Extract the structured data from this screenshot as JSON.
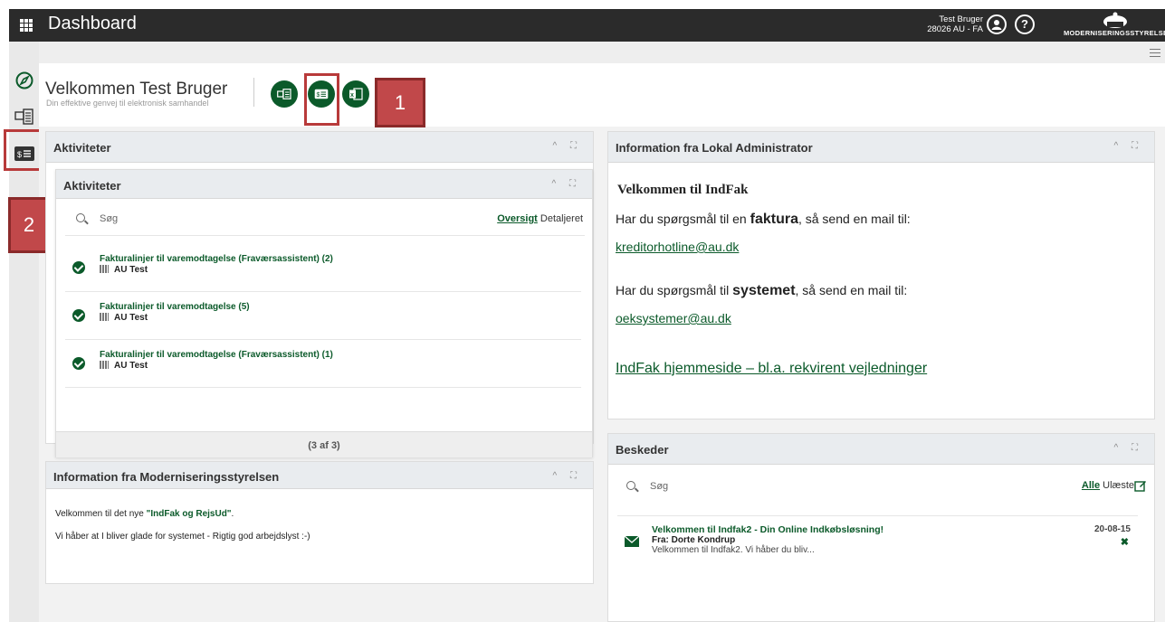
{
  "topbar": {
    "title": "Dashboard",
    "user_name": "Test Bruger",
    "user_org": "28026 AU - FA",
    "profile_icon": "user-circle-icon",
    "help_icon": "help-circle-icon",
    "brand_text": "Moderniseringsstyrelsen"
  },
  "welcome": {
    "title": "Velkommen Test Bruger",
    "subtitle": "Din effektive genvej til elektronisk samhandel"
  },
  "annotations": {
    "badge1": "1",
    "badge2": "2"
  },
  "activities_outer": {
    "title": "Aktiviteter"
  },
  "activities": {
    "title": "Aktiviteter",
    "search_placeholder": "Søg",
    "tab_overview": "Oversigt",
    "tab_detail": "Detaljeret",
    "items": [
      {
        "title": "Fakturalinjer til varemodtagelse (Fraværsassistent) (2)",
        "org": "AU Test"
      },
      {
        "title": "Fakturalinjer til varemodtagelse (5)",
        "org": "AU Test"
      },
      {
        "title": "Fakturalinjer til varemodtagelse (Fraværsassistent) (1)",
        "org": "AU Test"
      }
    ],
    "count": "(3 af 3)"
  },
  "modst": {
    "title": "Information fra Moderniseringsstyrelsen",
    "line1_pre": "Velkommen til det nye ",
    "line1_highlight": "\"IndFak og RejsUd\"",
    "line1_post": ".",
    "line2": "Vi håber at I bliver glade for systemet - Rigtig god arbejdslyst :-)"
  },
  "lokal": {
    "title": "Information fra Lokal Administrator",
    "heading": "Velkommen til IndFak",
    "q1_pre": "Har du spørgsmål til en ",
    "q1_bold": "faktura",
    "q1_post": ", så send en mail til:",
    "mail1": "kreditorhotline@au.dk",
    "q2_pre": "Har du spørgsmål til ",
    "q2_bold": "systemet",
    "q2_post": ", så send en mail til:",
    "mail2": "oeksystemer@au.dk",
    "homepage_link": "IndFak hjemmeside – bl.a. rekvirent vejledninger"
  },
  "messages": {
    "title": "Beskeder",
    "search_placeholder": "Søg",
    "tab_all": "Alle",
    "tab_unread": "Ulæste",
    "items": [
      {
        "title": "Velkommen til Indfak2 - Din Online Indkøbsløsning!",
        "from": "Fra: Dorte Kondrup",
        "preview": "Velkommen til Indfak2. Vi håber du bliv...",
        "date": "20-08-15"
      }
    ]
  },
  "colors": {
    "primary_green": "#0b5a2a",
    "annotation_red": "#c1484a",
    "topbar": "#2b2b2b"
  }
}
